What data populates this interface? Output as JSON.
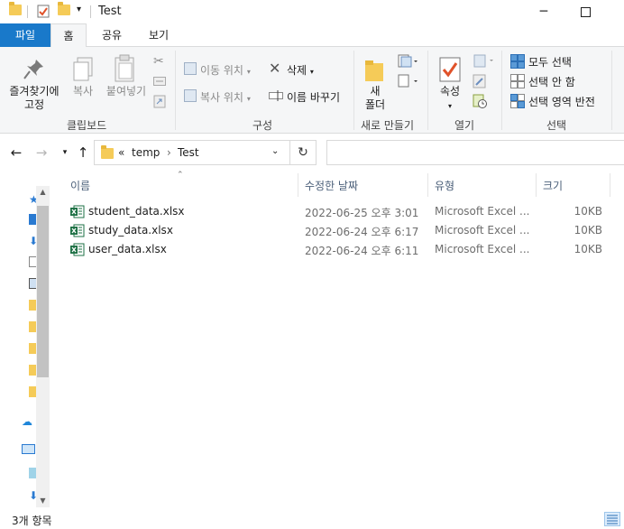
{
  "window": {
    "title": "Test",
    "minimize_glyph": "─",
    "maximize_glyph": "☐"
  },
  "ribbon_tabs": [
    {
      "label": "파일"
    },
    {
      "label": "홈"
    },
    {
      "label": "공유"
    },
    {
      "label": "보기"
    }
  ],
  "ribbon": {
    "clipboard": {
      "group_label": "클립보드",
      "pin_label_line1": "즐겨찾기에",
      "pin_label_line2": "고정",
      "copy_label": "복사",
      "paste_label": "붙여넣기"
    },
    "organize": {
      "group_label": "구성",
      "move_to": "이동 위치",
      "copy_to": "복사 위치",
      "delete": "삭제",
      "rename": "이름 바꾸기"
    },
    "new": {
      "group_label": "새로 만들기",
      "new_folder_line1": "새",
      "new_folder_line2": "폴더"
    },
    "open": {
      "group_label": "열기",
      "properties": "속성"
    },
    "select": {
      "group_label": "선택",
      "select_all": "모두 선택",
      "select_none": "선택 안 함",
      "invert_selection": "선택 영역 반전"
    }
  },
  "address": {
    "overflow": "«",
    "crumbs": [
      "temp",
      "Test"
    ],
    "separator": "›",
    "search_placeholder": ""
  },
  "columns": {
    "name": "이름",
    "date_modified": "수정한 날짜",
    "type": "유형",
    "size": "크기"
  },
  "files": [
    {
      "name": "student_data.xlsx",
      "date": "2022-06-25 오후 3:01",
      "type": "Microsoft Excel ...",
      "size": "10KB"
    },
    {
      "name": "study_data.xlsx",
      "date": "2022-06-24 오후 6:17",
      "type": "Microsoft Excel ...",
      "size": "10KB"
    },
    {
      "name": "user_data.xlsx",
      "date": "2022-06-24 오후 6:11",
      "type": "Microsoft Excel ...",
      "size": "10KB"
    }
  ],
  "status": {
    "item_count": "3개 항목"
  },
  "colors": {
    "accent": "#1979ca",
    "folder": "#f5cb58",
    "excel": "#1e7145"
  }
}
